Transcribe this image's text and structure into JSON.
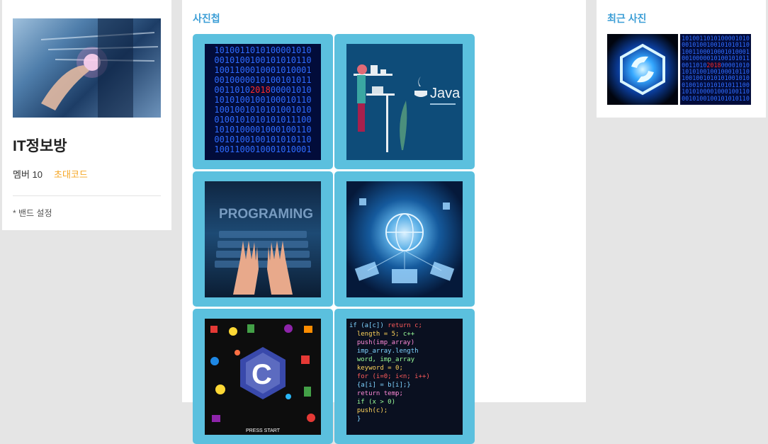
{
  "band": {
    "name": "IT정보방",
    "members_label": "멤버 10",
    "invite_label": "초대코드",
    "settings_label": "* 밴드 설정"
  },
  "album": {
    "title": "사진첩",
    "images": [
      {
        "subject": "binary-code-2018-image"
      },
      {
        "subject": "java-developer-image"
      },
      {
        "subject": "programming-keyboard-image"
      },
      {
        "subject": "network-globe-image"
      },
      {
        "subject": "c-language-game-image"
      },
      {
        "subject": "source-code-image"
      }
    ]
  },
  "recent": {
    "title": "최근 사진",
    "images": [
      {
        "subject": "glowing-hexagon-logo-image"
      },
      {
        "subject": "binary-code-2018-image"
      }
    ]
  },
  "image_text": {
    "binary_year": "2018",
    "java_text": "Java",
    "programming_text": "PROGRAMING",
    "c_letter": "C",
    "press_start": "PRESS START"
  },
  "colors": {
    "accent": "#3c9ed6",
    "invite": "#f5a623",
    "tile": "#5bc0de",
    "background": "#e5e5e5"
  }
}
